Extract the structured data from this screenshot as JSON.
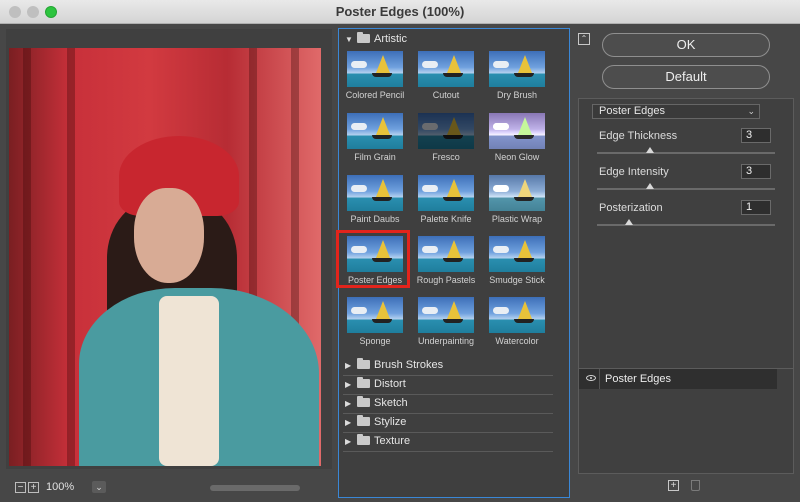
{
  "window": {
    "title": "Poster Edges (100%)"
  },
  "preview": {
    "zoom": "100%"
  },
  "gallery": {
    "categories": [
      {
        "name": "Artistic",
        "expanded": true,
        "filters": [
          "Colored Pencil",
          "Cutout",
          "Dry Brush",
          "Film Grain",
          "Fresco",
          "Neon Glow",
          "Paint Daubs",
          "Palette Knife",
          "Plastic Wrap",
          "Poster Edges",
          "Rough Pastels",
          "Smudge Stick",
          "Sponge",
          "Underpainting",
          "Watercolor"
        ]
      },
      {
        "name": "Brush Strokes",
        "expanded": false
      },
      {
        "name": "Distort",
        "expanded": false
      },
      {
        "name": "Sketch",
        "expanded": false
      },
      {
        "name": "Stylize",
        "expanded": false
      },
      {
        "name": "Texture",
        "expanded": false
      }
    ],
    "selected": "Poster Edges"
  },
  "buttons": {
    "ok": "OK",
    "default": "Default"
  },
  "settings": {
    "filter": "Poster Edges",
    "params": [
      {
        "label": "Edge Thickness",
        "value": "3",
        "slider": 0.3
      },
      {
        "label": "Edge Intensity",
        "value": "3",
        "slider": 0.3
      },
      {
        "label": "Posterization",
        "value": "1",
        "slider": 0.18
      }
    ]
  },
  "layers": {
    "items": [
      {
        "label": "Poster Edges",
        "visible": true
      }
    ]
  }
}
